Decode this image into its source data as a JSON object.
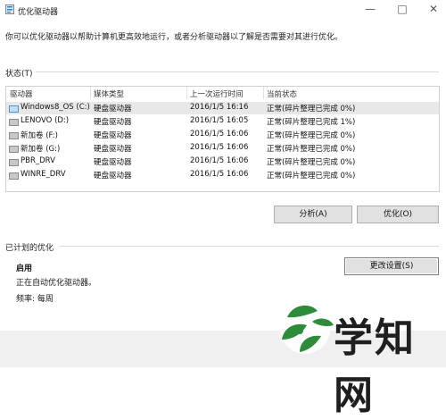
{
  "window": {
    "title": "优化驱动器"
  },
  "description": "你可以优化驱动器以帮助计算机更高效地运行，或者分析驱动器以了解是否需要对其进行优化。",
  "status_label": "状态(T)",
  "columns": [
    "驱动器",
    "媒体类型",
    "上一次运行时间",
    "当前状态"
  ],
  "drives": [
    {
      "name": "Windows8_OS (C:)",
      "media": "硬盘驱动器",
      "last_run": "2016/1/5 16:16",
      "status": "正常(碎片整理已完成 0%)",
      "icon": "windows-drive-icon"
    },
    {
      "name": "LENOVO (D:)",
      "media": "硬盘驱动器",
      "last_run": "2016/1/5 16:05",
      "status": "正常(碎片整理已完成 1%)",
      "icon": "drive-icon"
    },
    {
      "name": "新加卷 (F:)",
      "media": "硬盘驱动器",
      "last_run": "2016/1/5 16:06",
      "status": "正常(碎片整理已完成 0%)",
      "icon": "drive-icon"
    },
    {
      "name": "新加卷 (G:)",
      "media": "硬盘驱动器",
      "last_run": "2016/1/5 16:06",
      "status": "正常(碎片整理已完成 0%)",
      "icon": "drive-icon"
    },
    {
      "name": "PBR_DRV",
      "media": "硬盘驱动器",
      "last_run": "2016/1/5 16:06",
      "status": "正常(碎片整理已完成 0%)",
      "icon": "drive-icon"
    },
    {
      "name": "WINRE_DRV",
      "media": "硬盘驱动器",
      "last_run": "2016/1/5 16:06",
      "status": "正常(碎片整理已完成 0%)",
      "icon": "drive-icon"
    }
  ],
  "buttons": {
    "analyze": "分析(A)",
    "optimize": "优化(O)",
    "change_settings": "更改设置(S)"
  },
  "scheduled": {
    "label": "已计划的优化",
    "state": "启用",
    "detail": "正在自动优化驱动器。",
    "frequency": "频率: 每周"
  },
  "watermark": {
    "text": "学知网",
    "color": "#1f1f1f",
    "leaf_color": "#2e8b3a"
  },
  "colors": {
    "selected_row": "#e8e8e8",
    "button_bg": "#e1e1e1"
  }
}
